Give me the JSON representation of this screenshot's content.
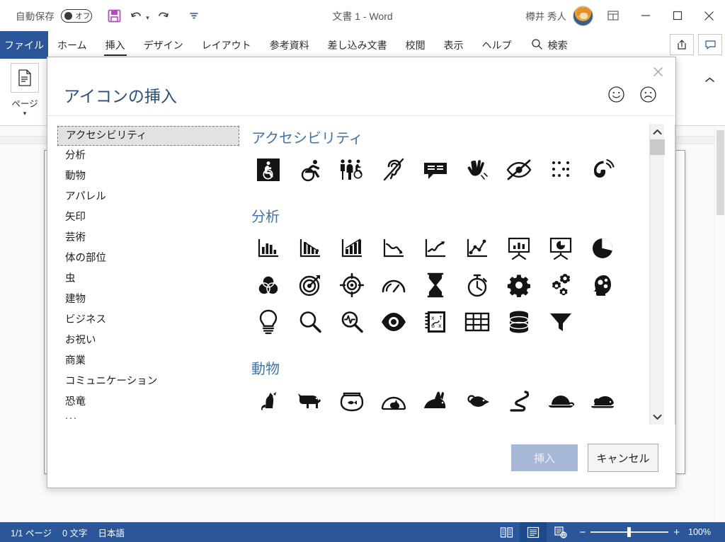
{
  "titlebar": {
    "autosave_label": "自動保存",
    "autosave_state": "オフ",
    "document_title": "文書 1 - Word",
    "user_name": "樽井 秀人",
    "save_icon": "save-icon",
    "undo_icon": "undo-icon",
    "redo_icon": "redo-icon",
    "more_icon": "more-commands-icon",
    "avatar": "user-avatar",
    "ribbon_display_icon": "ribbon-display-options-icon",
    "minimize_icon": "minimize-icon",
    "maximize_icon": "maximize-icon",
    "close_icon": "close-icon"
  },
  "ribbon": {
    "file_tab": "ファイル",
    "tabs": [
      {
        "label": "ホーム",
        "active": false
      },
      {
        "label": "挿入",
        "active": true
      },
      {
        "label": "デザイン",
        "active": false
      },
      {
        "label": "レイアウト",
        "active": false
      },
      {
        "label": "参考資料",
        "active": false
      },
      {
        "label": "差し込み文書",
        "active": false
      },
      {
        "label": "校閲",
        "active": false
      },
      {
        "label": "表示",
        "active": false
      },
      {
        "label": "ヘルプ",
        "active": false
      }
    ],
    "search_label": "検索",
    "search_icon": "search-icon",
    "share_icon": "share-icon",
    "comment_icon": "comment-icon",
    "page_group": {
      "label": "ページ",
      "icon": "page-icon",
      "caret": "▾"
    },
    "collapse_icon": "▲"
  },
  "dialog": {
    "title": "アイコンの挿入",
    "close_icon": "close-icon",
    "feedback_happy_icon": "smiley-happy-icon",
    "feedback_sad_icon": "smiley-sad-icon",
    "categories": [
      {
        "label": "アクセシビリティ",
        "selected": true
      },
      {
        "label": "分析",
        "selected": false
      },
      {
        "label": "動物",
        "selected": false
      },
      {
        "label": "アパレル",
        "selected": false
      },
      {
        "label": "矢印",
        "selected": false
      },
      {
        "label": "芸術",
        "selected": false
      },
      {
        "label": "体の部位",
        "selected": false
      },
      {
        "label": "虫",
        "selected": false
      },
      {
        "label": "建物",
        "selected": false
      },
      {
        "label": "ビジネス",
        "selected": false
      },
      {
        "label": "お祝い",
        "selected": false
      },
      {
        "label": "商業",
        "selected": false
      },
      {
        "label": "コミュニケーション",
        "selected": false
      },
      {
        "label": "恐竜",
        "selected": false
      }
    ],
    "categories_more": "...",
    "sections": [
      {
        "title": "アクセシビリティ",
        "rows": [
          [
            "wheelchair-sign-icon",
            "wheelchair-sport-icon",
            "restroom-accessible-icon",
            "hearing-impaired-icon",
            "closed-caption-icon",
            "sign-language-icon",
            "vision-impaired-icon",
            "braille-icon",
            "phone-ringing-icon"
          ]
        ]
      },
      {
        "title": "分析",
        "rows": [
          [
            "bar-chart-icon",
            "bar-chart-decline-icon",
            "bar-chart-growth-icon",
            "line-chart-down-icon",
            "line-chart-up-icon",
            "line-chart-points-icon",
            "presentation-bar-icon",
            "presentation-pie-icon",
            "pie-chart-icon"
          ],
          [
            "venn-diagram-icon",
            "target-arrow-icon",
            "crosshair-target-icon",
            "gauge-icon",
            "hourglass-icon",
            "stopwatch-icon",
            "gear-icon",
            "gears-icon",
            "head-gears-icon"
          ],
          [
            "lightbulb-icon",
            "magnifier-icon",
            "magnifier-pulse-icon",
            "eye-icon",
            "strategy-notebook-icon",
            "table-grid-icon",
            "database-icon",
            "funnel-icon"
          ]
        ]
      },
      {
        "title": "動物",
        "rows": [
          [
            "cat-icon",
            "dog-icon",
            "fishbowl-icon",
            "hamster-wheel-icon",
            "rabbit-icon",
            "mouse-icon",
            "snake-icon",
            "turtle-icon",
            "rat-icon"
          ]
        ]
      }
    ],
    "scroll_up_icon": "chevron-up-icon",
    "scroll_down_icon": "chevron-down-icon",
    "insert_button": "挿入",
    "cancel_button": "キャンセル"
  },
  "statusbar": {
    "page_info": "1/1 ページ",
    "word_count": "0 文字",
    "language": "日本語",
    "view_read_icon": "read-mode-icon",
    "view_print_icon": "print-layout-icon",
    "view_web_icon": "web-layout-icon",
    "zoom_out": "−",
    "zoom_in": "+",
    "zoom_level": "100%"
  }
}
